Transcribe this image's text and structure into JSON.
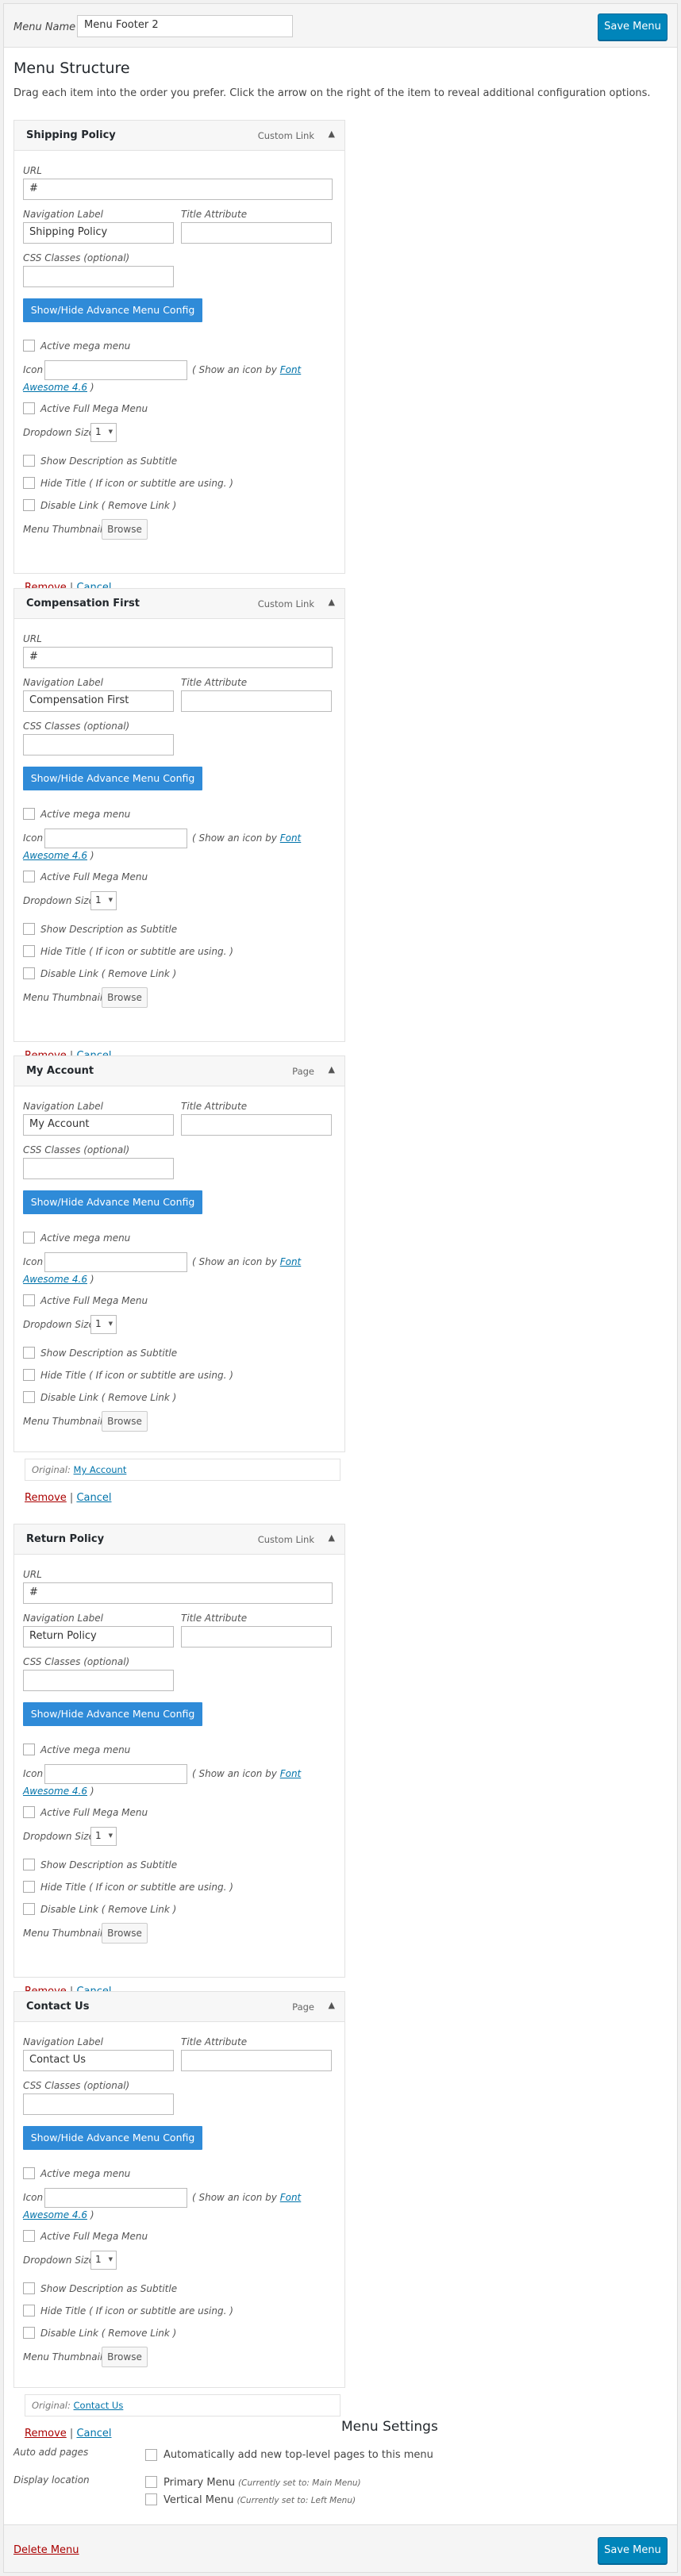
{
  "header": {
    "menu_name_label": "Menu Name",
    "menu_name_value": "Menu Footer 2",
    "save_label": "Save Menu"
  },
  "section": {
    "title": "Menu Structure",
    "instructions": "Drag each item into the order you prefer. Click the arrow on the right of the item to reveal additional configuration options."
  },
  "labels": {
    "url": "URL",
    "nav_label": "Navigation Label",
    "title_attr": "Title Attribute",
    "css_classes": "CSS Classes (optional)",
    "advance_btn": "Show/Hide Advance Menu Config",
    "active_mega": "Active mega menu",
    "icon": "Icon",
    "icon_hint_pre": "( Show an icon by",
    "icon_hint_link1": "Font",
    "icon_hint_link2": "Awesome 4.6",
    "icon_hint_post": ")",
    "active_full_mega": "Active Full Mega Menu",
    "dropdown_size": "Dropdown Size",
    "dropdown_value": "1",
    "show_desc": "Show Description as Subtitle",
    "hide_title": "Hide Title ( If icon or subtitle are using. )",
    "disable_link": "Disable Link ( Remove Link )",
    "menu_thumbnail": "Menu Thumbnail",
    "browse": "Browse",
    "original": "Original:",
    "remove": "Remove",
    "sep": "|",
    "cancel": "Cancel"
  },
  "items": [
    {
      "title": "Shipping Policy",
      "type": "Custom Link",
      "url": "#",
      "nav_label": "Shipping Policy",
      "original": null
    },
    {
      "title": "Compensation First",
      "type": "Custom Link",
      "url": "#",
      "nav_label": "Compensation First",
      "original": null
    },
    {
      "title": "My Account",
      "type": "Page",
      "url": null,
      "nav_label": "My Account",
      "original": "My Account"
    },
    {
      "title": "Return Policy",
      "type": "Custom Link",
      "url": "#",
      "nav_label": "Return Policy",
      "original": null
    },
    {
      "title": "Contact Us",
      "type": "Page",
      "url": null,
      "nav_label": "Contact Us",
      "original": "Contact Us"
    }
  ],
  "settings": {
    "title": "Menu Settings",
    "auto_add_label": "Auto add pages",
    "auto_add_text": "Automatically add new top-level pages to this menu",
    "display_location_label": "Display location",
    "locations": [
      {
        "name": "Primary Menu",
        "note": "(Currently set to: Main Menu)"
      },
      {
        "name": "Vertical Menu",
        "note": "(Currently set to: Left Menu)"
      }
    ]
  },
  "footer": {
    "delete_label": "Delete Menu",
    "save_label": "Save Menu"
  }
}
